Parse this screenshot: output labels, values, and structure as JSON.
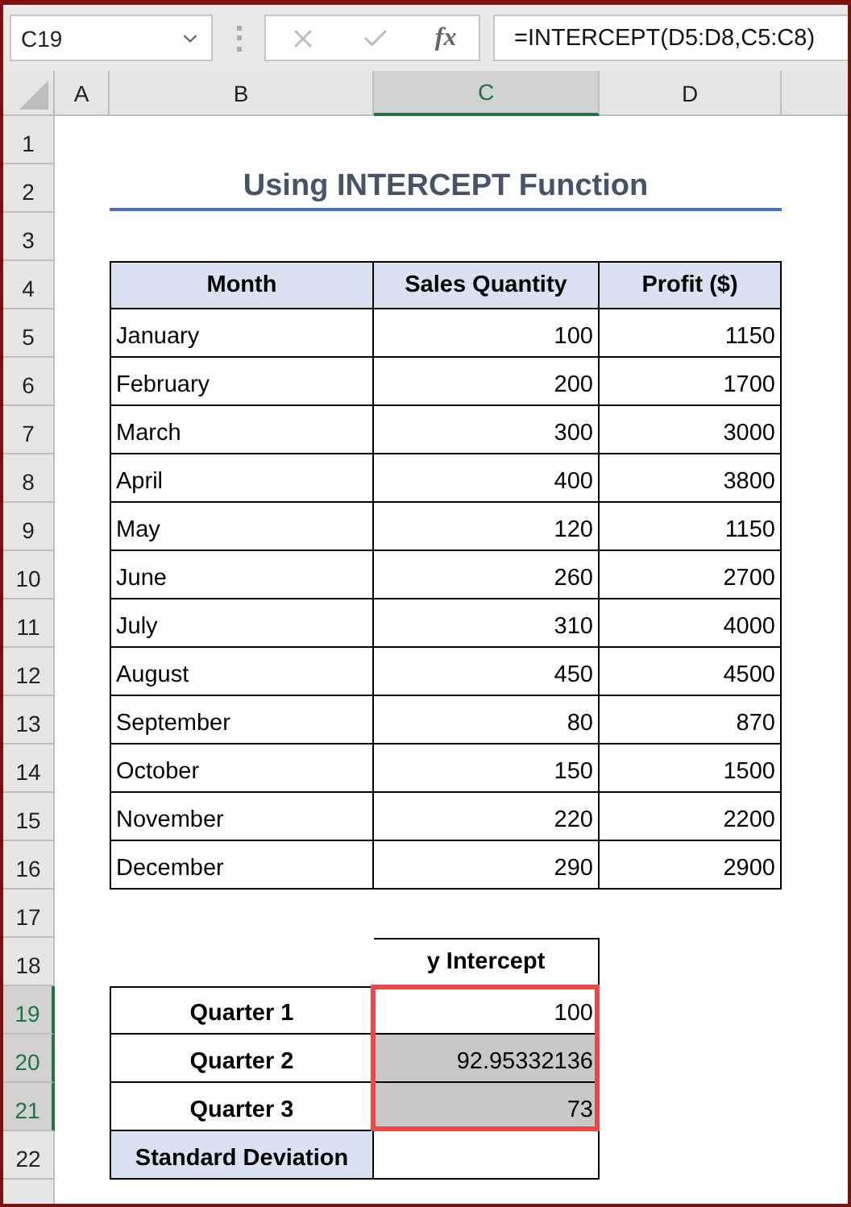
{
  "name_box": "C19",
  "fx_label": "fx",
  "formula": "=INTERCEPT(D5:D8,C5:C8)",
  "columns": [
    {
      "label": "A",
      "selected": false
    },
    {
      "label": "B",
      "selected": false
    },
    {
      "label": "C",
      "selected": true
    },
    {
      "label": "D",
      "selected": false
    }
  ],
  "rows": [
    {
      "label": "1",
      "selected": false
    },
    {
      "label": "2",
      "selected": false
    },
    {
      "label": "3",
      "selected": false
    },
    {
      "label": "4",
      "selected": false
    },
    {
      "label": "5",
      "selected": false
    },
    {
      "label": "6",
      "selected": false
    },
    {
      "label": "7",
      "selected": false
    },
    {
      "label": "8",
      "selected": false
    },
    {
      "label": "9",
      "selected": false
    },
    {
      "label": "10",
      "selected": false
    },
    {
      "label": "11",
      "selected": false
    },
    {
      "label": "12",
      "selected": false
    },
    {
      "label": "13",
      "selected": false
    },
    {
      "label": "14",
      "selected": false
    },
    {
      "label": "15",
      "selected": false
    },
    {
      "label": "16",
      "selected": false
    },
    {
      "label": "17",
      "selected": false
    },
    {
      "label": "18",
      "selected": false
    },
    {
      "label": "19",
      "selected": true
    },
    {
      "label": "20",
      "selected": true
    },
    {
      "label": "21",
      "selected": true
    },
    {
      "label": "22",
      "selected": false
    }
  ],
  "title": "Using INTERCEPT Function",
  "table": {
    "columns": [
      "Month",
      "Sales Quantity",
      "Profit ($)"
    ],
    "rows": [
      [
        "January",
        "100",
        "1150"
      ],
      [
        "February",
        "200",
        "1700"
      ],
      [
        "March",
        "300",
        "3000"
      ],
      [
        "April",
        "400",
        "3800"
      ],
      [
        "May",
        "120",
        "1150"
      ],
      [
        "June",
        "260",
        "2700"
      ],
      [
        "July",
        "310",
        "4000"
      ],
      [
        "August",
        "450",
        "4500"
      ],
      [
        "September",
        "80",
        "870"
      ],
      [
        "October",
        "150",
        "1500"
      ],
      [
        "November",
        "220",
        "2200"
      ],
      [
        "December",
        "290",
        "2900"
      ]
    ]
  },
  "summary": {
    "header": "y Intercept",
    "rows": [
      {
        "label": "Quarter 1",
        "value": "100",
        "selected": true
      },
      {
        "label": "Quarter 2",
        "value": "92.95332136",
        "selected": true
      },
      {
        "label": "Quarter 3",
        "value": "73",
        "selected": true
      },
      {
        "label": "Standard Deviation",
        "selected": false
      }
    ]
  }
}
